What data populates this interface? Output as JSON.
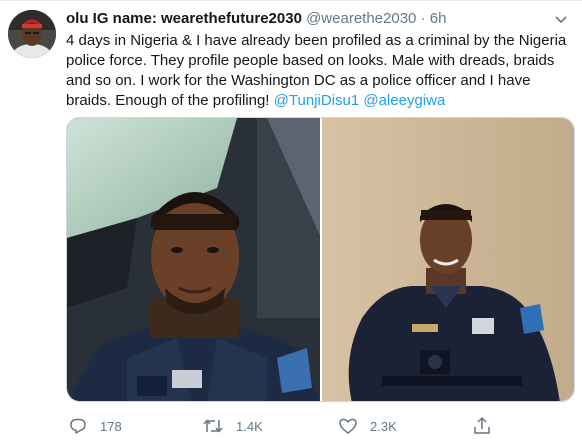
{
  "tweet": {
    "author": {
      "display_name": "olu IG name: wearethefuture2030",
      "handle": "@wearethe2030",
      "separator": "·",
      "time": "6h"
    },
    "text_main": "4 days in Nigeria & I have already been profiled as a criminal by the Nigeria police force. They profile people based on looks. Male with dreads, braids and so on. I work for the Washington DC as a police officer and I have braids. Enough of the profiling!",
    "mentions": [
      "@TunjiDisu1",
      "@aleeygiwa"
    ],
    "media": {
      "count": 2
    },
    "actions": {
      "replies": "178",
      "retweets": "1.4K",
      "likes": "2.3K"
    }
  },
  "icons": {
    "reply": "reply-icon",
    "retweet": "retweet-icon",
    "like": "like-icon",
    "share": "share-icon",
    "menu": "chevron-down-icon"
  },
  "colors": {
    "text": "#14171a",
    "secondary": "#657786",
    "link": "#1da1f2",
    "border": "#ccd6dd"
  }
}
